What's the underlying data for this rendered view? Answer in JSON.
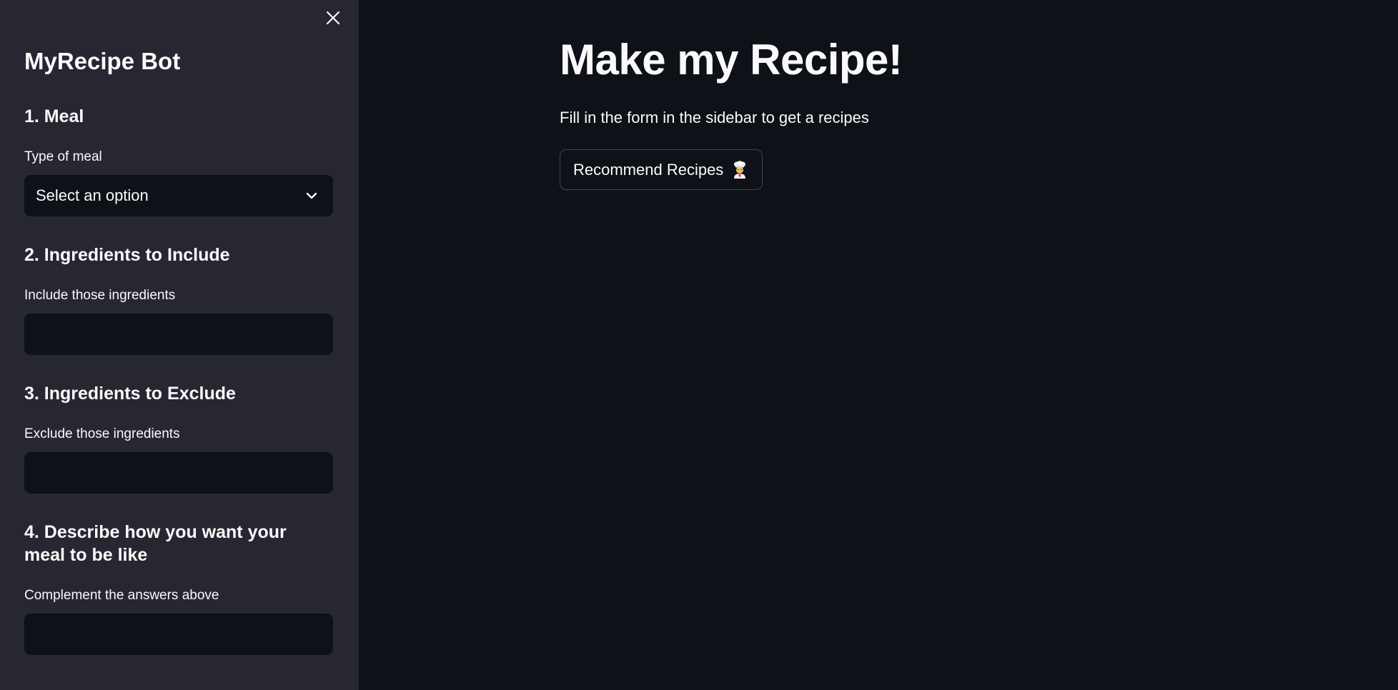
{
  "sidebar": {
    "title": "MyRecipe Bot",
    "sections": [
      {
        "heading": "1. Meal",
        "label": "Type of meal",
        "kind": "select",
        "value": "Select an option"
      },
      {
        "heading": "2. Ingredients to Include",
        "label": "Include those ingredients",
        "kind": "text",
        "value": ""
      },
      {
        "heading": "3. Ingredients to Exclude",
        "label": "Exclude those ingredients",
        "kind": "text",
        "value": ""
      },
      {
        "heading": "4. Describe how you want your meal to be like",
        "label": "Complement the answers above",
        "kind": "text",
        "value": ""
      }
    ],
    "close_icon": "close-icon"
  },
  "main": {
    "title": "Make my Recipe!",
    "subtitle": "Fill in the form in the sidebar to get a recipes",
    "button": {
      "label": "Recommend Recipes",
      "icon": "chef-icon"
    }
  },
  "colors": {
    "main_bg": "#0e1117",
    "sidebar_bg": "#262730",
    "input_bg": "#0e1117",
    "text": "#fafafa"
  }
}
